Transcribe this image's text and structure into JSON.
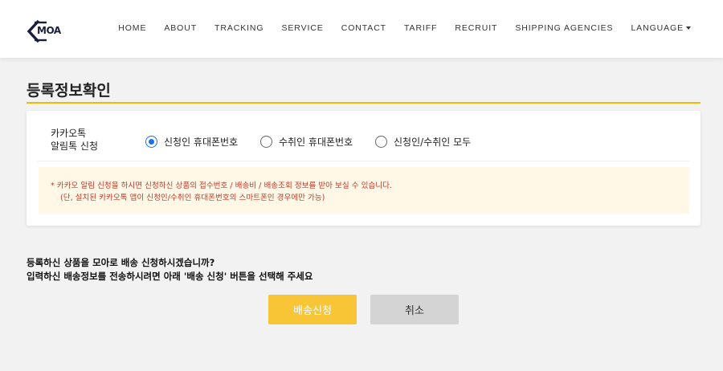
{
  "header": {
    "logo_text": "MOA",
    "nav": [
      {
        "label": "HOME"
      },
      {
        "label": "ABOUT"
      },
      {
        "label": "TRACKING"
      },
      {
        "label": "SERVICE"
      },
      {
        "label": "CONTACT"
      },
      {
        "label": "TARIFF"
      },
      {
        "label": "RECRUIT"
      },
      {
        "label": "SHIPPING AGENCIES"
      },
      {
        "label": "LANGUAGE"
      }
    ]
  },
  "page": {
    "title": "등록정보확인"
  },
  "kakao": {
    "label": "카카오톡\n알림톡 신청",
    "options": [
      {
        "label": "신청인 휴대폰번호",
        "selected": true
      },
      {
        "label": "수취인 휴대폰번호",
        "selected": false
      },
      {
        "label": "신청인/수취인 모두",
        "selected": false
      }
    ],
    "notice_line1": "*  카카오 알림 신청을 하시면 신청하신 상품의 접수번호 / 배송비 / 배송조회 정보를 받아 보실 수 있습니다.",
    "notice_line2": "(단, 설치된 카카오톡 앱이 신청인/수취인 휴대폰번호의 스마트폰인 경우에만 가능)"
  },
  "question": {
    "line1": "등록하신 상품을 모아로 배송 신청하시겠습니까?",
    "line2": "입력하신 배송정보를 전송하시려면 아래 '배송 신청' 버튼을 선택해 주세요"
  },
  "buttons": {
    "submit_label": "배송신청",
    "cancel_label": "취소"
  },
  "colors": {
    "accent": "#f5b800",
    "submit_button": "#f7c536",
    "cancel_button": "#d4d4d4",
    "notice_bg": "#fff8e6",
    "notice_text": "#c0392b",
    "radio_selected": "#1a73e8"
  }
}
